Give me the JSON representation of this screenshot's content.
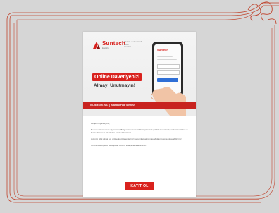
{
  "brand": {
    "name": "Suntech",
    "tagline": "Elektrik",
    "accent": "#d9221e"
  },
  "header_note": [
    "Elektrik ve Elektronik",
    "Fuarı",
    "Istanbul"
  ],
  "headline": {
    "line1": "Online Davetiyenizi",
    "line2": "Almayı Unutmayın!"
  },
  "date_strip": "05-08 Ekim 2022 | Istanbul Fuar Merkezi",
  "phone_app": {
    "logo": "Suntech"
  },
  "body_paragraphs": [
    "Değerli Ziyaretçimiz,",
    "Bu sene standımıza ziyaretiniz, Bölgenizi İstanbul'a Dönüştürecek şekilde hazırlandı, web sitemizden ve Suntech.com.tr üzerinden kayıt olabilirsiniz.",
    "Ayrıntılı bilgi almak ve online kayıt işlemlerinizi tamamlamak için aşağıdaki butona tıklayabilirsiniz.",
    "Online davetiyenizi aşağıdaki butona tıklayarak alabilirsiniz."
  ],
  "cta_label": "KAYIT OL",
  "colors": {
    "background": "#d6d6d6",
    "frame": "#c0442d",
    "card": "#ffffff",
    "strip": "#c8231f"
  }
}
